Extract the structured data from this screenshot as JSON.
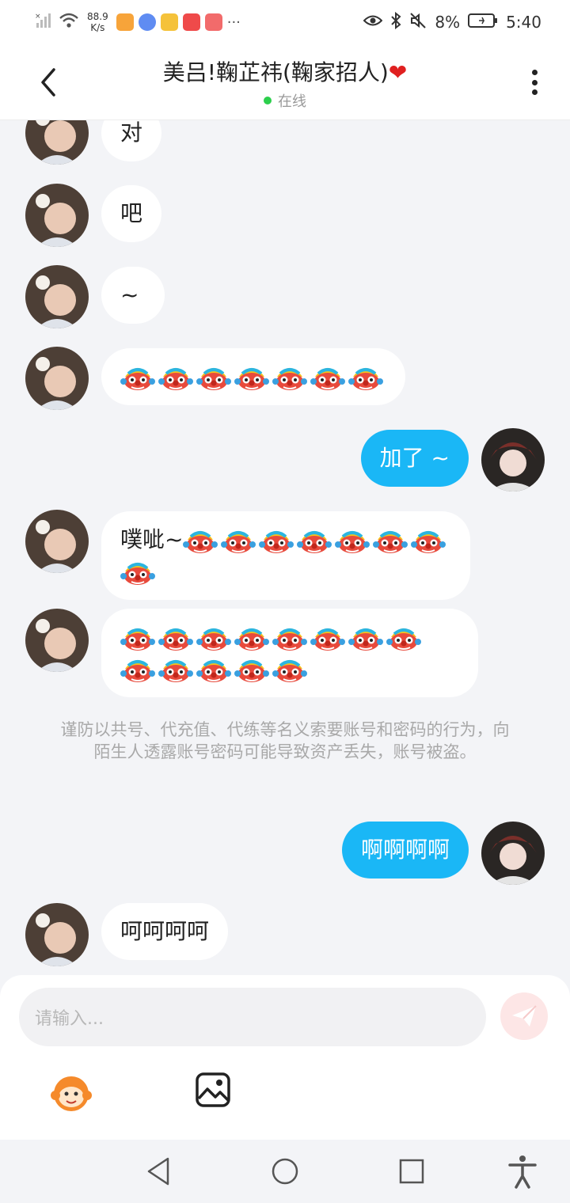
{
  "status_bar": {
    "network_speed_value": "88.9",
    "network_speed_unit": "K/s",
    "more_label": "···",
    "battery_percent": "8%",
    "time": "5:40",
    "icons": [
      "signal-icon",
      "wifi-icon",
      "video-app-icon",
      "music-app-icon",
      "media-app-icon",
      "app-100-icon",
      "mail-app-icon",
      "eye-icon",
      "bluetooth-icon",
      "mute-icon",
      "battery-icon"
    ]
  },
  "header": {
    "title": "美吕!鞠芷祎(鞠家招人)",
    "title_heart": "❤",
    "status": "在线"
  },
  "messages": [
    {
      "sender": "other",
      "text": "对"
    },
    {
      "sender": "other",
      "text": "吧"
    },
    {
      "sender": "other",
      "text": "~"
    },
    {
      "sender": "other",
      "text": "",
      "emoji_count": 7
    },
    {
      "sender": "me",
      "text": "加了 ~"
    },
    {
      "sender": "other",
      "text": "噗呲~",
      "emoji_count": 8
    },
    {
      "sender": "other",
      "text": "",
      "emoji_count": 13
    },
    {
      "sender": "me",
      "text": "啊啊啊啊"
    },
    {
      "sender": "other",
      "text": "呵呵呵呵"
    }
  ],
  "notice": "谨防以共号、代充值、代练等名义索要账号和密码的行为，向陌生人透露账号密码可能导致资产丢失，账号被盗。",
  "input": {
    "placeholder": "请输入..."
  },
  "colors": {
    "accent": "#1ab7f6",
    "online": "#2ccf4c",
    "heart": "#e02020",
    "send_bg": "#fde6e6"
  }
}
